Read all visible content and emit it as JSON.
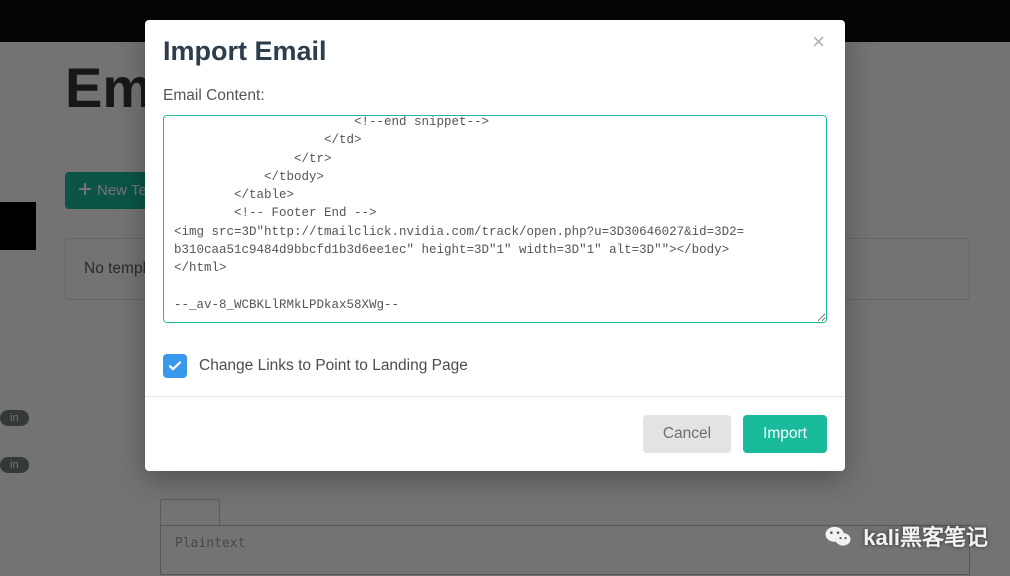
{
  "background": {
    "pageTitle": "Em",
    "newBtn": "New Te",
    "panelMsg": "No templ",
    "pill1": "in",
    "pill2": "in",
    "editorPlaceholder": "Plaintext"
  },
  "modal": {
    "title": "Import Email",
    "closeGlyph": "×",
    "contentLabel": "Email Content:",
    "textarea": "                        <!--end snippet-->\n                    </td>\n                </tr>\n            </tbody>\n        </table>\n        <!-- Footer End -->\n<img src=3D\"http://tmailclick.nvidia.com/track/open.php?u=3D30646027&id=3D2=\nb310caa51c9484d9bbcfd1b3d6ee1ec\" height=3D\"1\" width=3D\"1\" alt=3D\"\"></body>\n</html>\n\n--_av-8_WCBKLlRMkLPDkax58XWg--",
    "checkboxLabel": "Change Links to Point to Landing Page",
    "checkboxChecked": true,
    "cancel": "Cancel",
    "import": "Import"
  },
  "watermark": {
    "text": "kali黑客笔记"
  }
}
